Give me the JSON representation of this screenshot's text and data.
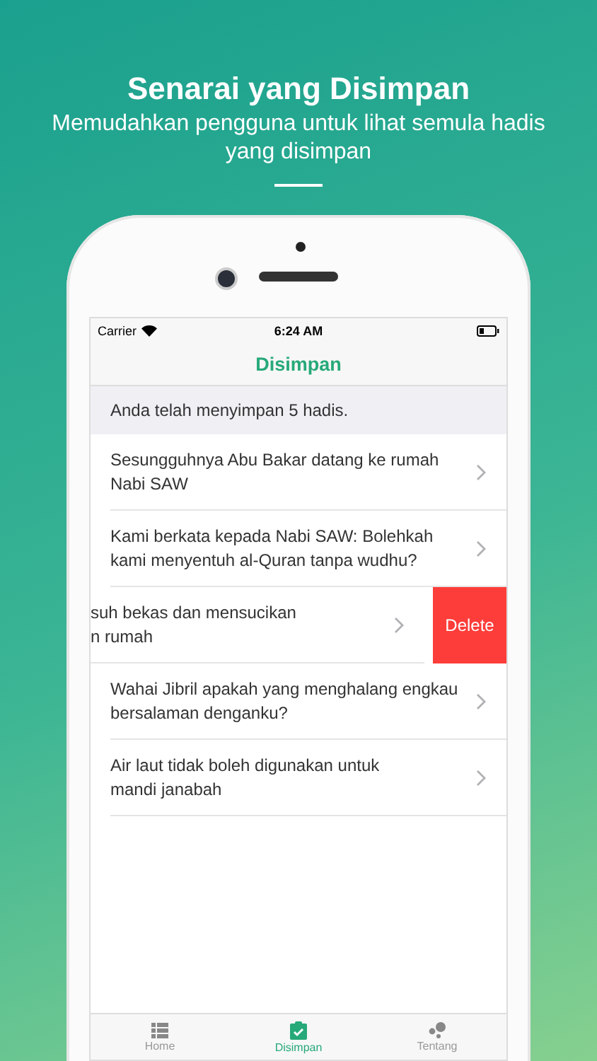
{
  "header": {
    "title": "Senarai yang Disimpan",
    "subtitle": "Memudahkan pengguna untuk lihat semula hadis yang disimpan"
  },
  "status_bar": {
    "carrier": "Carrier",
    "time": "6:24 AM"
  },
  "nav_bar": {
    "title": "Disimpan"
  },
  "info": "Anda telah menyimpan 5 hadis.",
  "rows": [
    {
      "kind": "normal",
      "lines": [
        "Sesungguhnya Abu Bakar datang ke rumah",
        "Nabi SAW"
      ]
    },
    {
      "kind": "normal",
      "lines": [
        "Kami berkata kepada Nabi SAW: Bolehkah",
        "kami menyentuh al-Quran tanpa wudhu?"
      ]
    },
    {
      "kind": "swiped",
      "lines": [
        "suh bekas dan mensucikan",
        "n rumah"
      ],
      "action": "Delete"
    },
    {
      "kind": "normal",
      "lines": [
        "Wahai Jibril apakah yang menghalang engkau",
        "bersalaman denganku?"
      ]
    },
    {
      "kind": "normal",
      "lines": [
        "Air laut tidak boleh digunakan untuk",
        "mandi janabah"
      ]
    }
  ],
  "tabs": [
    {
      "label": "Home",
      "selected": false
    },
    {
      "label": "Disimpan",
      "selected": true
    },
    {
      "label": "Tentang",
      "selected": false
    }
  ]
}
